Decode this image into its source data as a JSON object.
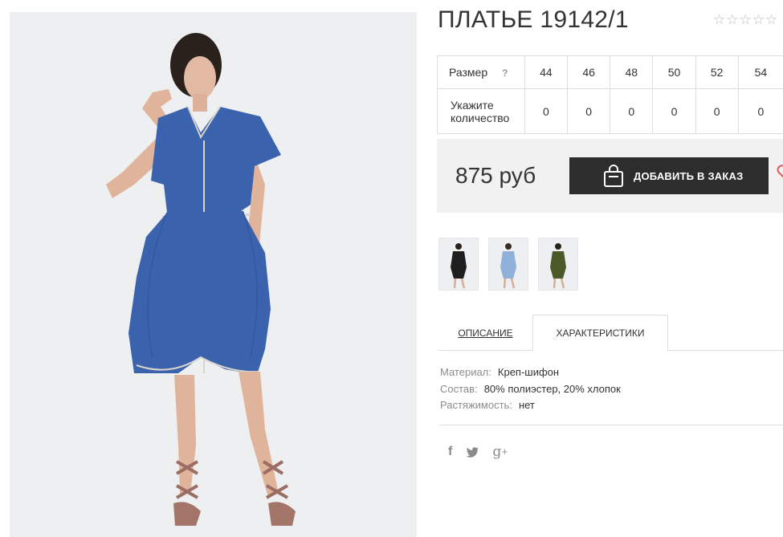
{
  "product": {
    "title": "ПЛАТЬЕ 19142/1",
    "rating_stars": 5
  },
  "size_table": {
    "size_label": "Размер",
    "help_icon": "?",
    "sizes": [
      "44",
      "46",
      "48",
      "50",
      "52",
      "54"
    ],
    "qty_label_line1": "Укажите",
    "qty_label_line2": "количество",
    "quantities": [
      "0",
      "0",
      "0",
      "0",
      "0",
      "0"
    ]
  },
  "purchase": {
    "price": "875 руб",
    "add_button_label": "ДОБАВИТЬ В ЗАКАЗ",
    "bag_icon": "shopping-bag-icon",
    "wishlist_icon": "heart-icon"
  },
  "thumbnails": [
    {
      "color": "black",
      "hex": "#1e1e1e"
    },
    {
      "color": "light-blue",
      "hex": "#8fb0d8"
    },
    {
      "color": "olive",
      "hex": "#4c5a2a"
    }
  ],
  "tabs": {
    "description": "ОПИСАНИЕ",
    "characteristics": "ХАРАКТЕРИСТИКИ",
    "active": "characteristics"
  },
  "characteristics": [
    {
      "key": "Материал:",
      "value": "Креп-шифон"
    },
    {
      "key": "Состав:",
      "value": "80% полиэстер, 20% хлопок"
    },
    {
      "key": "Растяжимость:",
      "value": "нет"
    }
  ],
  "social": {
    "facebook": "f",
    "twitter": "twitter-bird-icon",
    "gplus_g": "g",
    "gplus_plus": "+"
  },
  "colors": {
    "dress_blue": "#3b63ad",
    "button_dark": "#2d2d2d",
    "price_bg": "#f1f1f1",
    "photo_bg": "#eeeff1"
  }
}
